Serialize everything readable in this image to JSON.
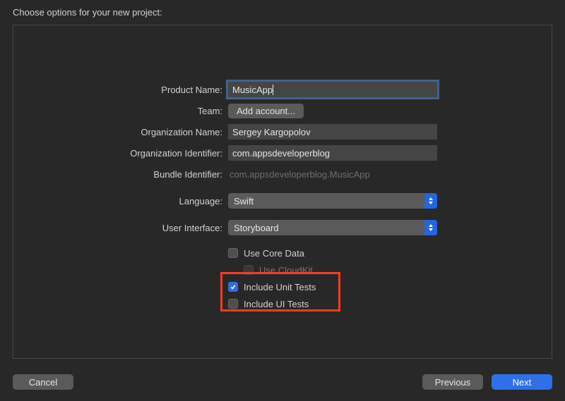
{
  "header": {
    "title": "Choose options for your new project:"
  },
  "labels": {
    "product_name": "Product Name:",
    "team": "Team:",
    "org_name": "Organization Name:",
    "org_id": "Organization Identifier:",
    "bundle_id": "Bundle Identifier:",
    "language": "Language:",
    "user_interface": "User Interface:"
  },
  "values": {
    "product_name": "MusicApp",
    "add_account": "Add account...",
    "org_name": "Sergey Kargopolov",
    "org_id": "com.appsdeveloperblog",
    "bundle_id": "com.appsdeveloperblog.MusicApp",
    "language": "Swift",
    "user_interface": "Storyboard"
  },
  "checkboxes": {
    "core_data": {
      "label": "Use Core Data",
      "checked": false,
      "disabled": false
    },
    "cloudkit": {
      "label": "Use CloudKit",
      "checked": false,
      "disabled": true
    },
    "unit_tests": {
      "label": "Include Unit Tests",
      "checked": true,
      "disabled": false
    },
    "ui_tests": {
      "label": "Include UI Tests",
      "checked": false,
      "disabled": false
    }
  },
  "footer": {
    "cancel": "Cancel",
    "previous": "Previous",
    "next": "Next"
  }
}
